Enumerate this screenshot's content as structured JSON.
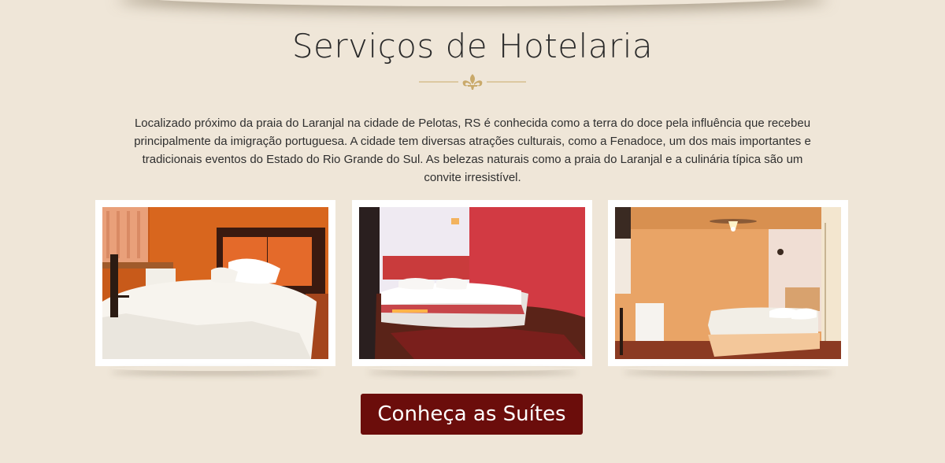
{
  "section": {
    "title": "Serviços de Hotelaria",
    "intro": "Localizado próximo da praia do Laranjal na cidade de Pelotas, RS é conhecida como a terra do doce pela influência que recebeu principalmente da imigração portuguesa. A cidade tem diversas atrações culturais, como a Fenadoce, um dos mais importantes e tradicionais eventos do Estado do Rio Grande do Sul. As belezas naturais como a praia do Laranjal e a culinária típica são um convite irresistível."
  },
  "ornament": {
    "icon": "fleur-de-lis-icon",
    "color": "#c9a96a"
  },
  "gallery": {
    "photos": [
      {
        "name": "suite-photo-orange-bedroom"
      },
      {
        "name": "suite-photo-red-bedroom"
      },
      {
        "name": "suite-photo-peach-bedroom"
      }
    ]
  },
  "cta": {
    "label": "Conheça as Suítes",
    "color": "#6b0d0b"
  },
  "colors": {
    "background": "#efe6d8",
    "frame": "#ffffff",
    "text": "#2b2b2b"
  }
}
